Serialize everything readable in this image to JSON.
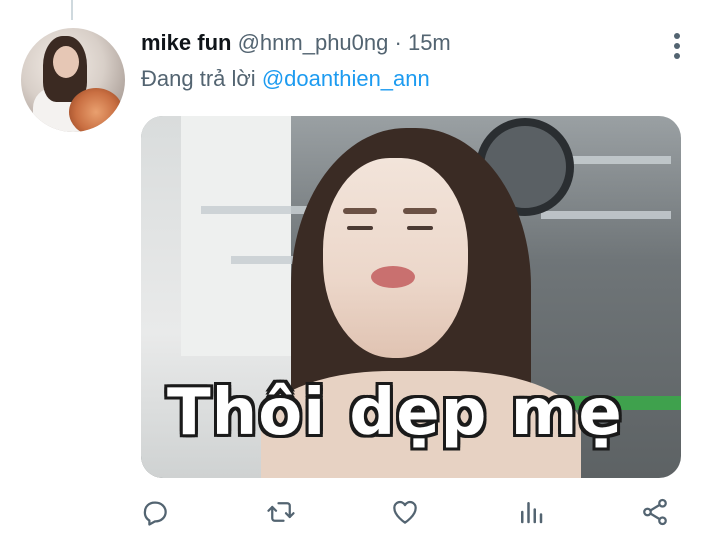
{
  "tweet": {
    "display_name": "mike fun",
    "handle": "@hnm_phu0ng",
    "separator": "·",
    "time": "15m",
    "reply_prefix": "Đang trả lời",
    "reply_mention": "@doanthien_ann",
    "media": {
      "caption": "Thôi dẹp mẹ"
    }
  },
  "actions": {
    "icons": [
      "reply-icon",
      "retweet-icon",
      "like-icon",
      "analytics-icon",
      "share-icon"
    ]
  },
  "colors": {
    "text_primary": "#0f1419",
    "text_secondary": "#536471",
    "link": "#1d9bf0",
    "thread_line": "#cfd9de"
  }
}
